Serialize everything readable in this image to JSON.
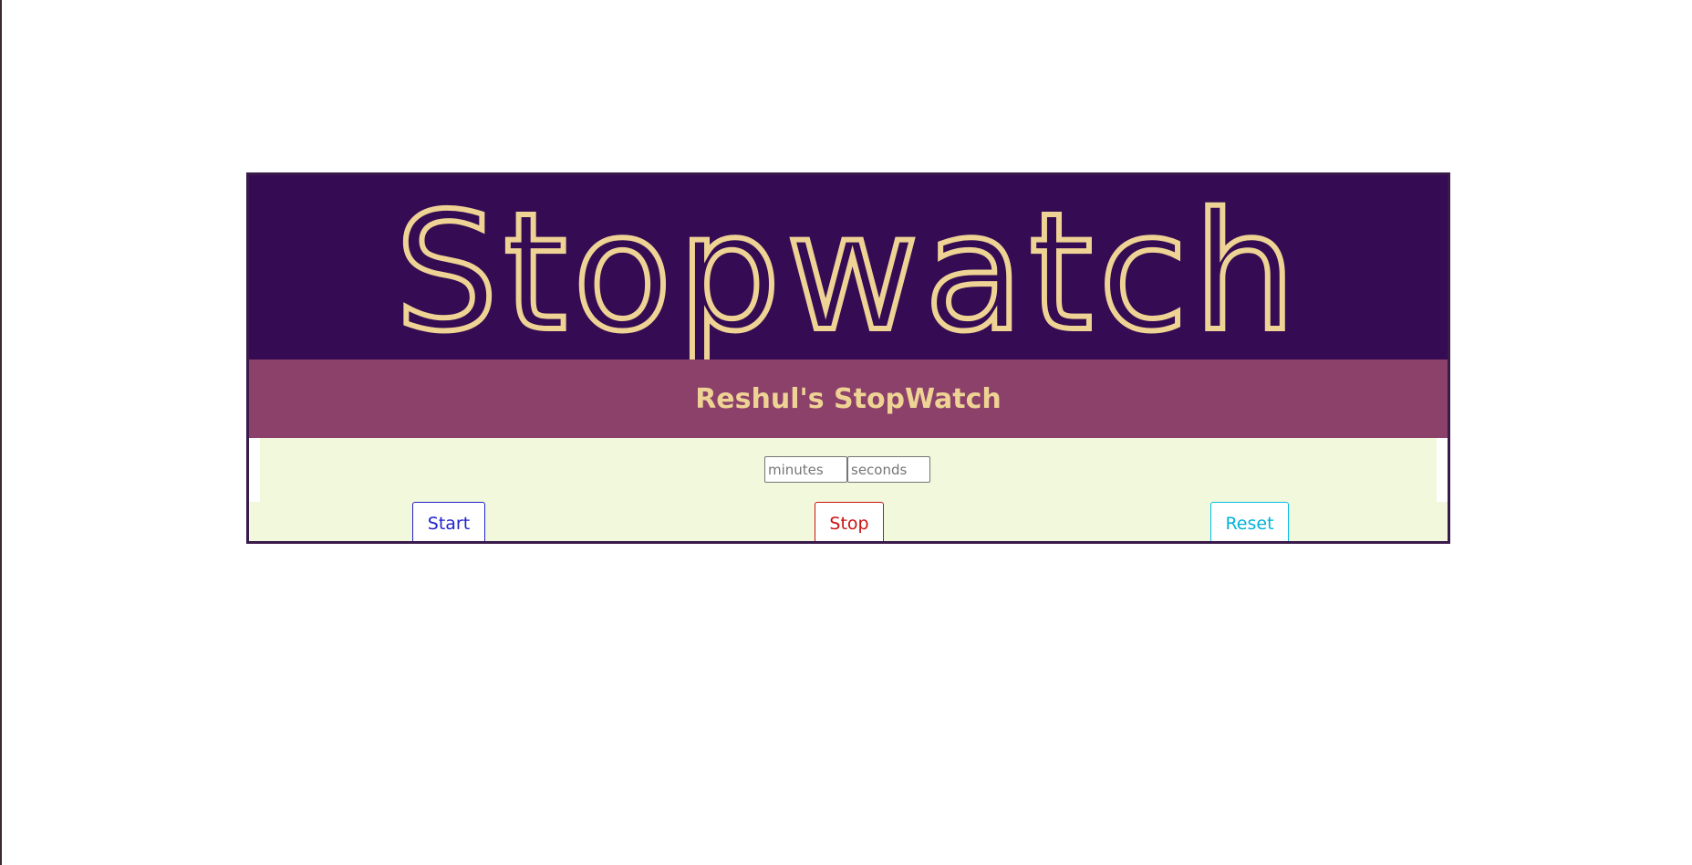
{
  "app": {
    "title": "Stopwatch",
    "subtitle": "Reshul's StopWatch"
  },
  "inputs": {
    "minutes_placeholder": "minutes",
    "seconds_placeholder": "seconds",
    "minutes_value": "",
    "seconds_value": ""
  },
  "buttons": {
    "start_label": "Start",
    "stop_label": "Stop",
    "reset_label": "Reset"
  },
  "colors": {
    "header_bg": "#350b53",
    "subheader_bg": "#8b416a",
    "title_text": "#eed394",
    "panel_bg": "#f2f8dc",
    "start": "#2222cc",
    "stop": "#cc1111",
    "reset": "#00bfe6"
  }
}
